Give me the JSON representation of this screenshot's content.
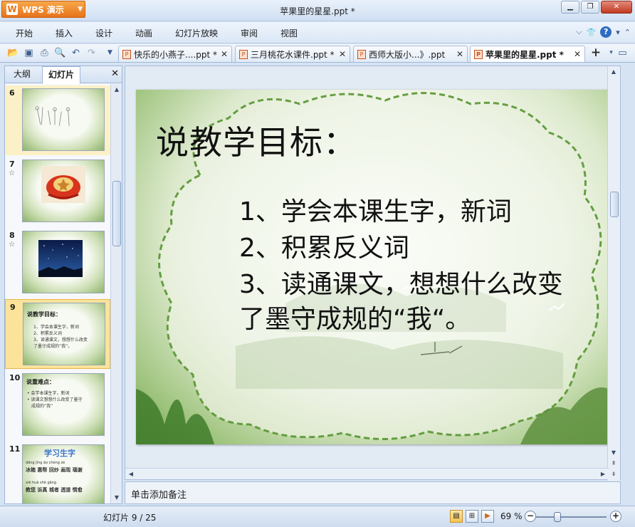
{
  "app": {
    "name": "WPS 演示",
    "title": "苹果里的星星.ppt *"
  },
  "menu": [
    "开始",
    "插入",
    "设计",
    "动画",
    "幻灯片放映",
    "审阅",
    "视图"
  ],
  "tabs": [
    {
      "label": "快乐的小燕子....ppt *",
      "active": false
    },
    {
      "label": "三月桃花水课件.ppt *",
      "active": false
    },
    {
      "label": "西师大版小...》.ppt",
      "active": false
    },
    {
      "label": "苹果里的星星.ppt *",
      "active": true
    }
  ],
  "left_panel": {
    "tab_outline": "大纲",
    "tab_slides": "幻灯片",
    "thumbs": [
      {
        "num": "6"
      },
      {
        "num": "7"
      },
      {
        "num": "8"
      },
      {
        "num": "9",
        "title": "说教学目标：",
        "lines": [
          "1、学会本课生字，新词",
          "2、积累反义词",
          "3、读通课文，想想什么改变",
          "了墨守成规的“我”。"
        ]
      },
      {
        "num": "10",
        "title": "说重难点：",
        "lines": [
          "• 会学本课生字，新词",
          "• 读课文想想什么改变了墨守",
          "成规的“我”"
        ]
      },
      {
        "num": "11",
        "title": "学习生字",
        "lines": [
          "dāng   jīng    ào     chéng    zé",
          "冰箱  惠帮  回炒  画现  瑙谢",
          "       xiē    huā    shè   gāng",
          "教您  诉真  城者  透道  情愈"
        ]
      }
    ]
  },
  "slide": {
    "title": "说教学目标：",
    "lines": [
      "1、学会本课生字，新词",
      "2、积累反义词",
      "3、读通课文，想想什么改变",
      "  了墨守成规的“我“。"
    ]
  },
  "notes_placeholder": "单击添加备注",
  "status": {
    "slide_indicator": "幻灯片 9 / 25",
    "zoom": "69 %"
  },
  "colors": {
    "app_orange": "#e8731a",
    "ribbon_blue": "#dbe7f6",
    "selected_thumb": "#fbe39a"
  }
}
